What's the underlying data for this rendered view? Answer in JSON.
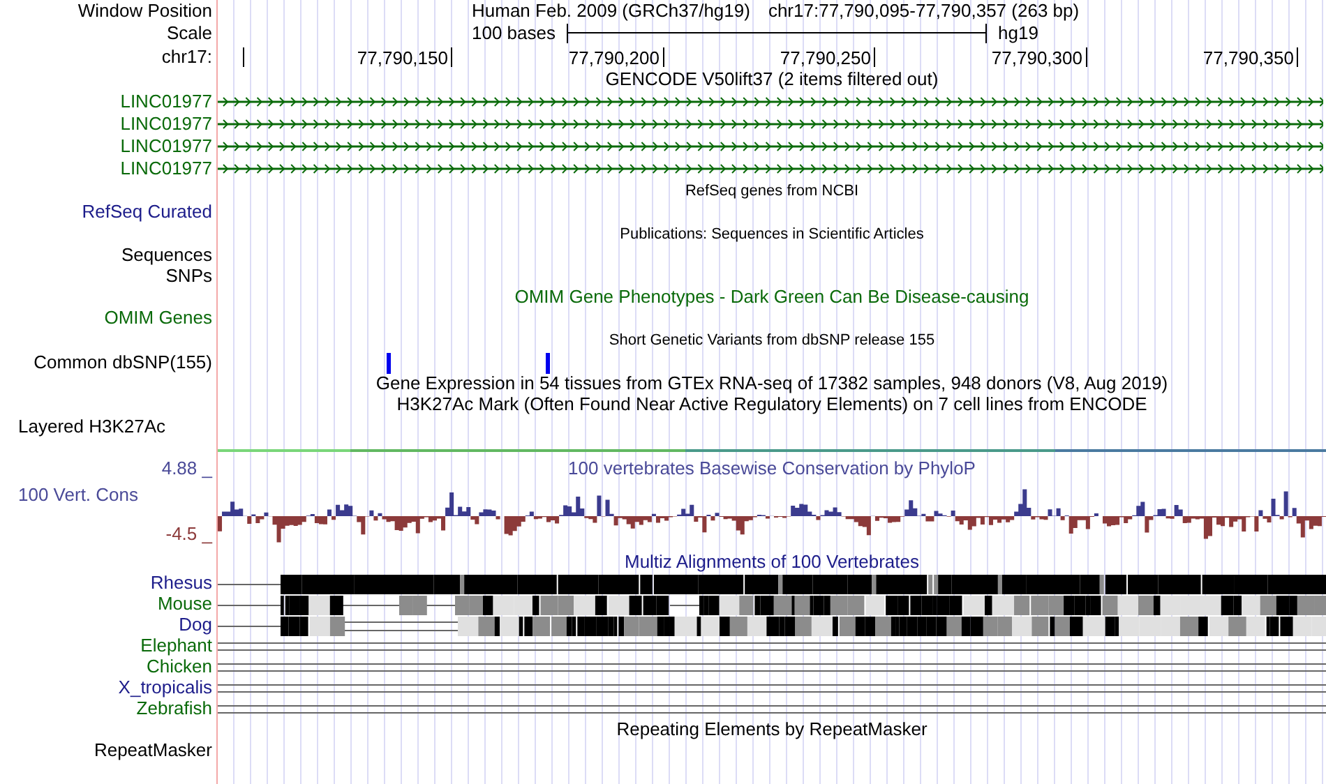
{
  "rows": [
    {
      "kind": "position",
      "label": "Window Position",
      "title": "Human Feb. 2009 (GRCh37/hg19)",
      "position": "chr17:77,790,095-77,790,357 (263 bp)"
    },
    {
      "kind": "scale",
      "label": "Scale",
      "scale_text": "100 bases",
      "assembly": "hg19"
    },
    {
      "kind": "ruler",
      "label": "chr17:",
      "ticks": [
        "77,790,150",
        "77,790,200",
        "77,790,250",
        "77,790,300",
        "77,790,350"
      ]
    },
    {
      "kind": "title",
      "title": "GENCODE V50lift37 (2 items filtered out)",
      "color": "#000000"
    },
    {
      "kind": "gene",
      "label": "LINC01977",
      "color": "#0a6a0a"
    },
    {
      "kind": "gene",
      "label": "LINC01977",
      "color": "#0a6a0a"
    },
    {
      "kind": "gene",
      "label": "LINC01977",
      "color": "#0a6a0a"
    },
    {
      "kind": "gene",
      "label": "LINC01977",
      "color": "#0a6a0a"
    },
    {
      "kind": "small_title",
      "title": "RefSeq genes from NCBI",
      "color": "#000000"
    },
    {
      "kind": "label",
      "label": "RefSeq Curated",
      "color": "#1c1c8a"
    },
    {
      "kind": "small_title",
      "title": "Publications: Sequences in Scientific Articles",
      "color": "#000000"
    },
    {
      "kind": "label",
      "label": "Sequences",
      "color": "#000000"
    },
    {
      "kind": "label",
      "label": "SNPs",
      "color": "#000000"
    },
    {
      "kind": "title",
      "title": "OMIM Gene Phenotypes - Dark Green Can Be Disease-causing",
      "color": "#0a6a0a"
    },
    {
      "kind": "label",
      "label": "OMIM Genes",
      "color": "#0a6a0a"
    },
    {
      "kind": "small_title",
      "title": "Short Genetic Variants from dbSNP release 155",
      "color": "#000000"
    },
    {
      "kind": "snp",
      "label": "Common dbSNP(155)",
      "color": "#000000"
    },
    {
      "kind": "title",
      "title": "Gene Expression in 54 tissues from GTEx RNA-seq of 17382 samples, 948 donors (V8, Aug 2019)",
      "color": "#000000"
    },
    {
      "kind": "title",
      "title": "H3K27Ac Mark (Often Found Near Active Regulatory Elements) on 7 cell lines from ENCODE",
      "color": "#000000"
    },
    {
      "kind": "layered",
      "label": "Layered H3K27Ac",
      "color": "#000000"
    },
    {
      "kind": "conservation",
      "title": "100 vertebrates Basewise Conservation by PhyloP",
      "label": "100 Vert. Cons",
      "max": "4.88 _",
      "min": "-4.5 _",
      "color": "#4a4a98"
    },
    {
      "kind": "title",
      "title": "Multiz Alignments of 100 Vertebrates",
      "color": "#1c1c8a"
    },
    {
      "kind": "aligned",
      "label": "Rhesus",
      "color": "#1c1c8a"
    },
    {
      "kind": "aligned",
      "label": "Mouse",
      "color": "#0a6a0a"
    },
    {
      "kind": "aligned",
      "label": "Dog",
      "color": "#1c1c8a"
    },
    {
      "kind": "unaligned",
      "label": "Elephant",
      "color": "#0a6a0a"
    },
    {
      "kind": "unaligned",
      "label": "Chicken",
      "color": "#0a6a0a"
    },
    {
      "kind": "unaligned",
      "label": "X_tropicalis",
      "color": "#1c1c8a"
    },
    {
      "kind": "unaligned",
      "label": "Zebrafish",
      "color": "#0a6a0a"
    },
    {
      "kind": "title",
      "title": "Repeating Elements by RepeatMasker",
      "color": "#000000"
    },
    {
      "kind": "label",
      "label": "RepeatMasker",
      "color": "#000000"
    }
  ]
}
